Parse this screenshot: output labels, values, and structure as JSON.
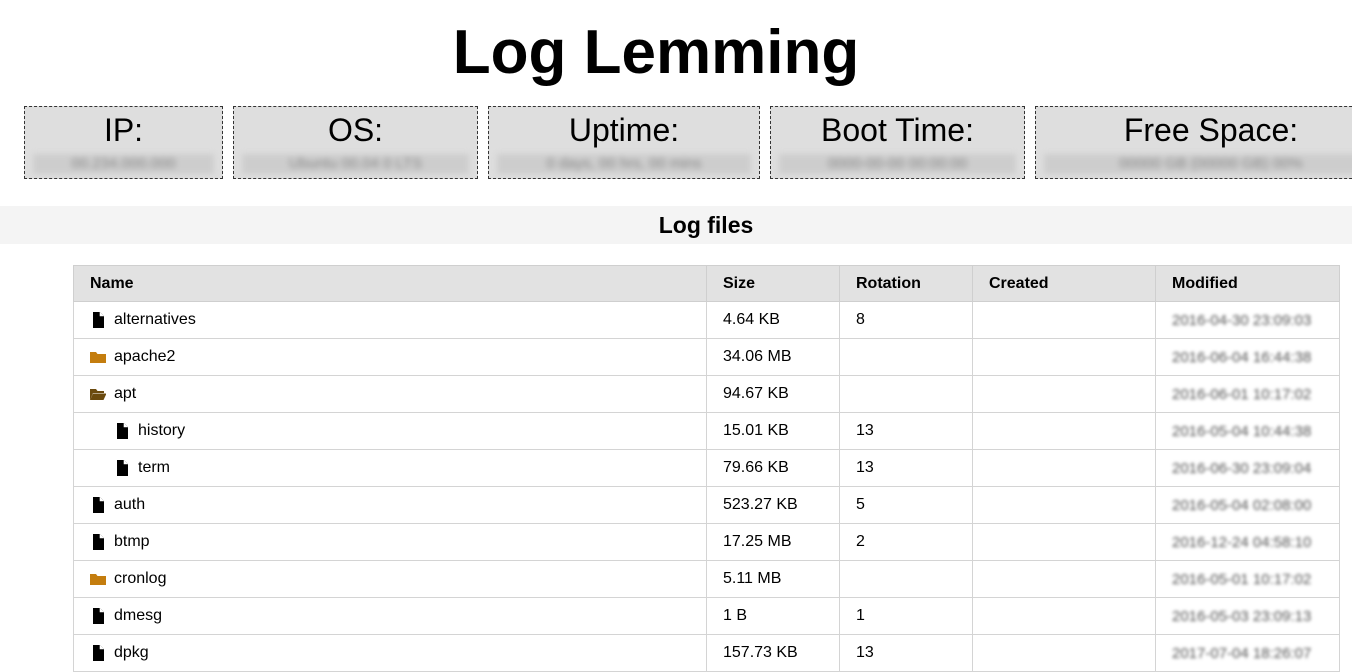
{
  "app": {
    "title": "Log Lemming"
  },
  "stats": [
    {
      "label": "IP:",
      "value": "00.234.000.000"
    },
    {
      "label": "OS:",
      "value": "Ubuntu 00.04 0 LTS"
    },
    {
      "label": "Uptime:",
      "value": "0 days, 00 hrs, 00 mins"
    },
    {
      "label": "Boot Time:",
      "value": "0000-00-00 00:00:00"
    },
    {
      "label": "Free Space:",
      "value": "00000 GB (00000 GB) 00%"
    }
  ],
  "section": {
    "title": "Log files"
  },
  "table": {
    "headers": [
      "Name",
      "Size",
      "Rotation",
      "Created",
      "Modified"
    ],
    "rows": [
      {
        "name": "alternatives",
        "type": "file",
        "depth": 0,
        "size": "4.64 KB",
        "rotation": "8",
        "created": "",
        "modified": "2016-04-30 23:09:03"
      },
      {
        "name": "apache2",
        "type": "folder",
        "depth": 0,
        "size": "34.06 MB",
        "rotation": "",
        "created": "",
        "modified": "2016-06-04 16:44:38"
      },
      {
        "name": "apt",
        "type": "folder-open",
        "depth": 0,
        "size": "94.67 KB",
        "rotation": "",
        "created": "",
        "modified": "2016-06-01 10:17:02"
      },
      {
        "name": "history",
        "type": "file",
        "depth": 1,
        "size": "15.01 KB",
        "rotation": "13",
        "created": "",
        "modified": "2016-05-04 10:44:38"
      },
      {
        "name": "term",
        "type": "file",
        "depth": 1,
        "size": "79.66 KB",
        "rotation": "13",
        "created": "",
        "modified": "2016-06-30 23:09:04"
      },
      {
        "name": "auth",
        "type": "file",
        "depth": 0,
        "size": "523.27 KB",
        "rotation": "5",
        "created": "",
        "modified": "2016-05-04 02:08:00"
      },
      {
        "name": "btmp",
        "type": "file",
        "depth": 0,
        "size": "17.25 MB",
        "rotation": "2",
        "created": "",
        "modified": "2016-12-24 04:58:10"
      },
      {
        "name": "cronlog",
        "type": "folder",
        "depth": 0,
        "size": "5.11 MB",
        "rotation": "",
        "created": "",
        "modified": "2016-05-01 10:17:02"
      },
      {
        "name": "dmesg",
        "type": "file",
        "depth": 0,
        "size": "1 B",
        "rotation": "1",
        "created": "",
        "modified": "2016-05-03 23:09:13"
      },
      {
        "name": "dpkg",
        "type": "file",
        "depth": 0,
        "size": "157.73 KB",
        "rotation": "13",
        "created": "",
        "modified": "2017-07-04 18:26:07"
      }
    ]
  },
  "colors": {
    "folder": "#c47d0e",
    "folder_open": "#6b4a0e",
    "header_bg": "#e2e2e2",
    "stat_bg": "#dedede"
  },
  "icons": {
    "file": "file-icon",
    "folder": "folder-icon",
    "folder-open": "folder-open-icon"
  }
}
